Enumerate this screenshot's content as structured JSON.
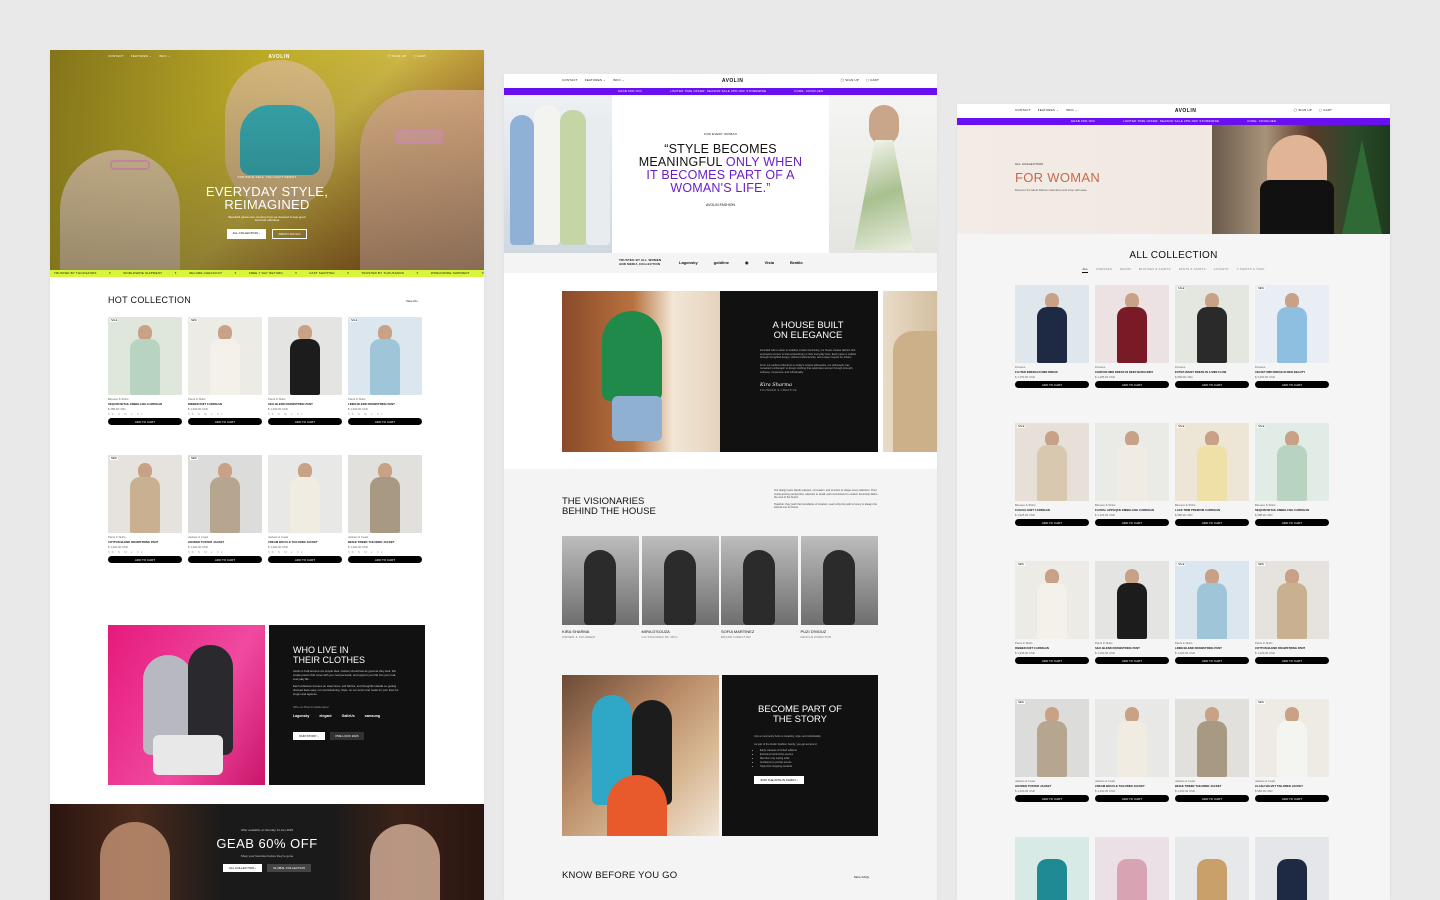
{
  "brand": "AVOLIN",
  "nav": {
    "contact": "CONTACT",
    "features": "FEATURES ⌄",
    "info": "INFO ⌄",
    "signup": "SIGN UP",
    "cart": "CART"
  },
  "home": {
    "eyebrow": "FOR BOLD SELF, YOU CAN'T RESIST",
    "title_1": "EVERYDAY STYLE,",
    "title_2": "REIMAGINED",
    "subtitle": "Beautiful pieces are nonstop how we dressed to feel good and trust effortless",
    "cta_primary": "ALL COLLECTION  ›",
    "cta_secondary": "ABOUT AVOLIN",
    "ticker": [
      "TRUSTED BY THOUSANDS",
      "WORLDWIDE SHIPMENT",
      "SECURE CHECKOUT",
      "FREE 7 DAY RETURN",
      "FAST SHIPPING",
      "TRUSTED BY THOUSANDS",
      "WORLDWIDE SHIPMENT",
      "SECURE CHECKOUT"
    ],
    "hot_title": "HOT COLLECTION",
    "view_all": "View All  ›",
    "products": [
      {
        "badge": "SALE",
        "type": "Blouses & Shirts",
        "name": "SEQUIN DETAIL EMBELLISH CARDIGAN",
        "price": "$ 288.00 USD",
        "sizes": "XS S M L XL",
        "cta": "ADD TO CART"
      },
      {
        "badge": "NEW",
        "type": "Pants & Skirts",
        "name": "RIBBED KNIT CARDIGAN",
        "price": "$ 1,300.00 USD",
        "sizes": "XS S M L XL",
        "cta": "ADD TO CART"
      },
      {
        "badge": "",
        "type": "Pants & Skirts",
        "name": "SILK BLEND DRAWSTRING PANT",
        "price": "$ 1,400.00 USD",
        "sizes": "XS S M L XL",
        "cta": "ADD TO CART"
      },
      {
        "badge": "SALE",
        "type": "Pants & Skirts",
        "name": "LINEN BLEND DRAWSTRING PANT",
        "price": "$ 1,200.00 USD",
        "sizes": "XS S M L XL",
        "cta": "ADD TO CART"
      },
      {
        "badge": "NEW",
        "type": "Pants & Skirts",
        "name": "COTTON BLEND DRAWSTRING PANT",
        "price": "$ 1,200.00 USD",
        "sizes": "XS S M L XL",
        "cta": "ADD TO CART"
      },
      {
        "badge": "NEW",
        "type": "Jackets & Coats",
        "name": "HOODED PUFFER JACKET",
        "price": "$ 1,400.00 USD",
        "sizes": "XS S M L XL",
        "cta": "ADD TO CART"
      },
      {
        "badge": "",
        "type": "Jackets & Coats",
        "name": "CREAM BOUCLE TAILORED JACKET",
        "price": "$ 1,400.00 USD",
        "sizes": "XS S M L XL",
        "cta": "ADD TO CART"
      },
      {
        "badge": "",
        "type": "Jackets & Coats",
        "name": "BEIGE TWEED TAILORED JACKET",
        "price": "$ 1,400.00 USD",
        "sizes": "XS S M L XL",
        "cta": "ADD TO CART"
      }
    ],
    "who_title_1": "WHO LIVE IN",
    "who_title_2": "THEIR CLOTHES",
    "who_p1": "Avolin is built around one simple idea: clothes should feel as good as they look. We create pieces that move with you, feel personal, and support your life into your real, everyday life.",
    "who_p2": "Each collection focuses on clean lines, soft fabrics, and thoughtful details so getting dressed feels easy, not overwhelming. Style, on our terms and made for your lives for longer and ageless.",
    "who_partners_label": "With our Brand Collaboration",
    "who_partners": [
      "Lagonsky",
      "elegant",
      "GalleUs",
      "samsung"
    ],
    "who_btn1": "OUR STORY  ›",
    "who_btn2": "PRE LOOK 2026",
    "offer_eyebrow": "Offer available on Monday 31 Jan 2026",
    "offer_title": "GEAB 60% OFF",
    "offer_sub": "Shop your favorites before they're gone",
    "offer_btn1": "ALL COLLECTION  ›",
    "offer_btn2": "GLOBAL COLLECTION"
  },
  "about": {
    "promo": [
      "GRAB 60% OFF",
      "LIMITED TIME OFFER: SEASON SALE 25% OFF STOREWIDE",
      "CODE: CONCHIEN"
    ],
    "quote_eyebrow": "FOR EVERY WOMAN",
    "quote_l1": "“STYLE BECOMES",
    "quote_l2": "MEANINGFUL ",
    "quote_l2b": "ONLY WHEN",
    "quote_l3": "IT BECOMES PART OF A",
    "quote_l4": "WOMAN'S LIFE.”",
    "quote_by": "AVOLIN FASHION",
    "trusted": "TRUSTED BY ALL WOMEN AND MEDIA COLLECTION",
    "logos": [
      "Lagonsky",
      "goldline",
      "◉",
      "Vista",
      "Bratilo"
    ],
    "house_title_1": "A HOUSE BUILT",
    "house_title_2": "ON ELEGANCE",
    "house_p1": "Founded with a vision to redefine modern femininity, our house creates fashion that empowers women to feel extraordinary in their everyday lives. Each piece is crafted through thoughtful design, refined craftsmanship, and a deep respect for artistry.",
    "house_p2": "From our earliest collections to today's newest silhouettes, our philosophy has remained unchanged: to design clothing that celebrates women through strength, softness, movement, and individuality.",
    "signature": "Kira Sharma",
    "signature_role": "FOUNDER & CREATIVE",
    "vis_title_1": "THE VISIONARIES",
    "vis_title_2": "BEHIND THE HOUSE",
    "vis_p1": "Our design team blends passion, innovation, and emotion to shape every collection. Their contemporary perspective, attention to detail, and commitment to modern femininity define the soul of the brand.",
    "vis_p2": "Together, they push the boundaries of creation. Learn why the path to luxury is always the eternal one for future.",
    "team": [
      {
        "name": "KIRA SHARMA",
        "role": "OWNER & FOUNDER"
      },
      {
        "name": "MIRA D'SOUZA",
        "role": "CO-FOUNDER OF MFG"
      },
      {
        "name": "SOFIA MARTINEZ",
        "role": "BRAND DIRECTOR"
      },
      {
        "name": "PUZI D'MOUZ",
        "role": "DESIGN DIRECTOR"
      }
    ],
    "join_title_1": "BECOME PART OF",
    "join_title_2": "THE STORY",
    "join_p1": "Join a community built on creativity, style, and individuality.",
    "join_p2": "As part of the Avolin Fashion Family, you get access to:",
    "join_list": [
      "Early releases & limited editions",
      "Exclusive behind-the-scenes",
      "Member-only styling edits",
      "Invitations to private events",
      "Style-first shopping rewards"
    ],
    "join_btn": "JOIN THE AVOLIN FAMILY  ›",
    "faq_title": "KNOW BEFORE YOU GO",
    "faq_more": "More FAQs"
  },
  "shop": {
    "promo": [
      "GRAB 60% OFF",
      "LIMITED TIME OFFER: SEASON SALE 25% OFF STOREWIDE",
      "CODE: CONCHIEN"
    ],
    "eyebrow": "ALL COLLECTION",
    "title": "FOR WOMAN",
    "subtitle": "Discover the latest fashion collections and shop with ease.",
    "grid_title": "ALL COLLECTION",
    "filters": [
      "ALL",
      "DRESSES",
      "DENIM",
      "BLOUSES & SHIRTS",
      "PANTS & SKIRTS",
      "JACKETS",
      "T-SHIRTS & TANK"
    ],
    "products": [
      {
        "badge": "",
        "type": "Dresses",
        "name": "FLUTED EMERALD MIDI DRESS",
        "price": "$ 1,750.00 USD",
        "cta": "ADD TO CART"
      },
      {
        "badge": "",
        "type": "Dresses",
        "name": "CHIFFON MIDI DRESS IN DEEP BURGUNDY",
        "price": "$ 1,285.00 USD",
        "cta": "ADD TO CART"
      },
      {
        "badge": "SALE",
        "type": "Dresses",
        "name": "EXTRA WAIST DRESS IN A MIDI FLOW",
        "price": "$ 899.00 USD",
        "cta": "ADD TO CART"
      },
      {
        "badge": "NEW",
        "type": "Dresses",
        "name": "VELVET MIDI DRESS IN RED BEAUTY",
        "price": "$ 3,450.00 USD",
        "cta": "ADD TO CART"
      },
      {
        "badge": "SALE",
        "type": "Blouses & Shirts",
        "name": "CASUAL KNIT CARDIGAN",
        "price": "$ 1,025.00 USD",
        "cta": "ADD TO CART"
      },
      {
        "badge": "",
        "type": "Blouses & Shirts",
        "name": "FLORAL APPLIQUE EMBELLISH CARDIGAN",
        "price": "$ 1,169.00 USD",
        "cta": "ADD TO CART"
      },
      {
        "badge": "SALE",
        "type": "Blouses & Shirts",
        "name": "LACE TRIM PREMIUM CARDIGAN",
        "price": "$ 980.00 USD",
        "cta": "ADD TO CART"
      },
      {
        "badge": "SALE",
        "type": "Blouses & Shirts",
        "name": "SEQUIN DETAIL EMBELLISH CARDIGAN",
        "price": "$ 288.00 USD",
        "cta": "ADD TO CART"
      },
      {
        "badge": "NEW",
        "type": "Pants & Skirts",
        "name": "RIBBED KNIT CARDIGAN",
        "price": "$ 1,295.00 USD",
        "cta": "ADD TO CART"
      },
      {
        "badge": "",
        "type": "Pants & Skirts",
        "name": "SILK BLEND DRAWSTRING PANT",
        "price": "$ 1,400.00 USD",
        "cta": "ADD TO CART"
      },
      {
        "badge": "SALE",
        "type": "Pants & Skirts",
        "name": "LINEN BLEND DRAWSTRING PANT",
        "price": "$ 1,200.00 USD",
        "cta": "ADD TO CART"
      },
      {
        "badge": "NEW",
        "type": "Pants & Skirts",
        "name": "COTTON BLEND DRAWSTRING PANT",
        "price": "$ 1,200.00 USD",
        "cta": "ADD TO CART"
      },
      {
        "badge": "NEW",
        "type": "Jackets & Coats",
        "name": "HOODED PUFFER JACKET",
        "price": "$ 1,400.00 USD",
        "cta": "ADD TO CART"
      },
      {
        "badge": "",
        "type": "Jackets & Coats",
        "name": "CREAM BOUCLE TAILORED JACKET",
        "price": "$ 1,400.00 USD",
        "cta": "ADD TO CART"
      },
      {
        "badge": "",
        "type": "Jackets & Coats",
        "name": "BEIGE TWEED TAILORED JACKET",
        "price": "$ 1,400.00 USD",
        "cta": "ADD TO CART"
      },
      {
        "badge": "NEW",
        "type": "Jackets & Coats",
        "name": "CLASH VELVET TAILORED JACKET",
        "price": "$ 950.00 USD",
        "cta": "ADD TO CART"
      }
    ]
  },
  "colors": {
    "accent_purple": "#6a0ff0",
    "accent_lime": "#d7f53a",
    "quote_purple": "#6a1fc8",
    "dark": "#111111"
  }
}
